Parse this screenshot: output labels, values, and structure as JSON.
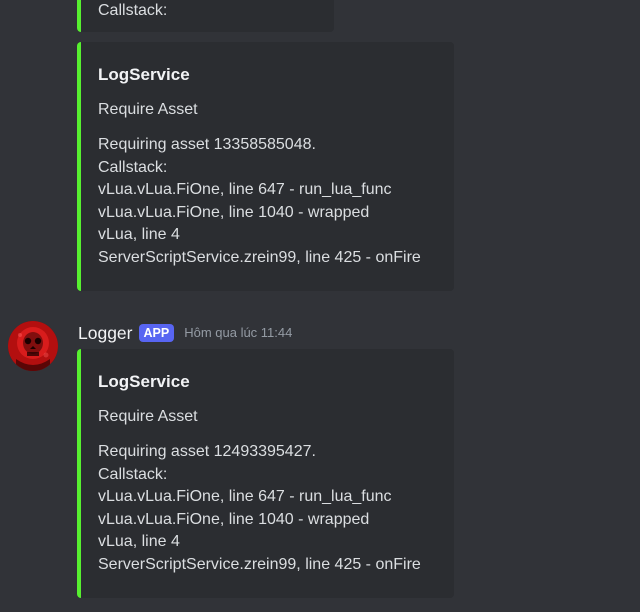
{
  "messages": [
    {
      "embed": {
        "partial_text": "Callstack:"
      }
    },
    {
      "embed": {
        "title": "LogService",
        "description": "Require Asset",
        "lines": [
          "Requiring asset 13358585048.",
          "Callstack:",
          "vLua.vLua.FiOne, line 647 - run_lua_func",
          "vLua.vLua.FiOne, line 1040 - wrapped",
          "vLua, line 4",
          "ServerScriptService.zrein99, line 425 - onFire"
        ]
      }
    },
    {
      "author": "Logger",
      "badge": "APP",
      "timestamp": "Hôm qua lúc 11:44",
      "embed": {
        "title": "LogService",
        "description": "Require Asset",
        "lines": [
          "Requiring asset 12493395427.",
          "Callstack:",
          "vLua.vLua.FiOne, line 647 - run_lua_func",
          "vLua.vLua.FiOne, line 1040 - wrapped",
          "vLua, line 4",
          "ServerScriptService.zrein99, line 425 - onFire"
        ]
      }
    }
  ],
  "colors": {
    "background": "#313338",
    "embed_background": "#2b2d31",
    "embed_border": "#57f030",
    "badge": "#5865f2",
    "timestamp": "#949ba4"
  },
  "icons": {
    "avatar": "red-skull-avatar-icon"
  }
}
